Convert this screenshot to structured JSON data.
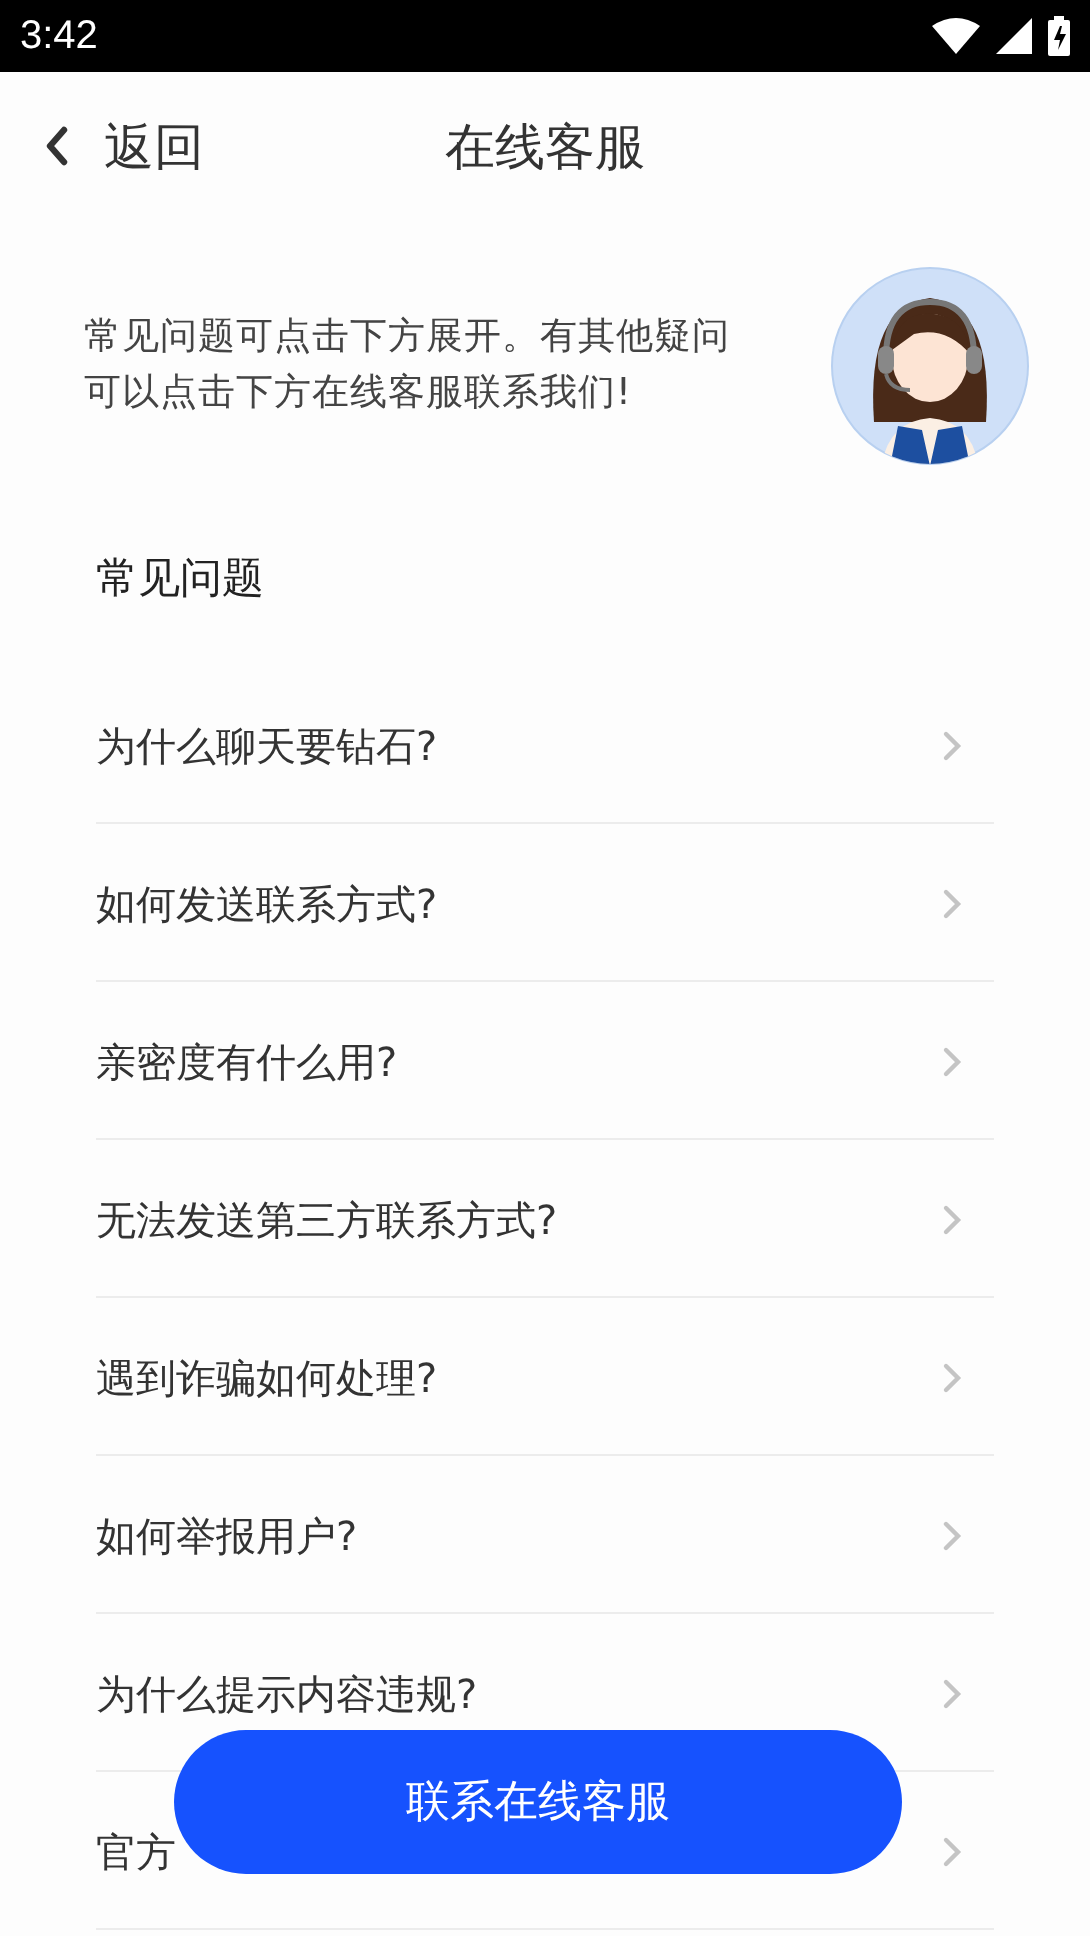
{
  "status_bar": {
    "time": "3:42"
  },
  "header": {
    "back_label": "返回",
    "title": "在线客服"
  },
  "intro": {
    "text": "常见问题可点击下方展开。有其他疑问可以点击下方在线客服联系我们!"
  },
  "faq": {
    "heading": "常见问题",
    "items": [
      {
        "question": "为什么聊天要钻石?"
      },
      {
        "question": "如何发送联系方式?"
      },
      {
        "question": "亲密度有什么用?"
      },
      {
        "question": "无法发送第三方联系方式?"
      },
      {
        "question": "遇到诈骗如何处理?"
      },
      {
        "question": "如何举报用户?"
      },
      {
        "question": "为什么提示内容违规?"
      },
      {
        "question": "官方"
      }
    ]
  },
  "contact_button": {
    "label": "联系在线客服"
  }
}
